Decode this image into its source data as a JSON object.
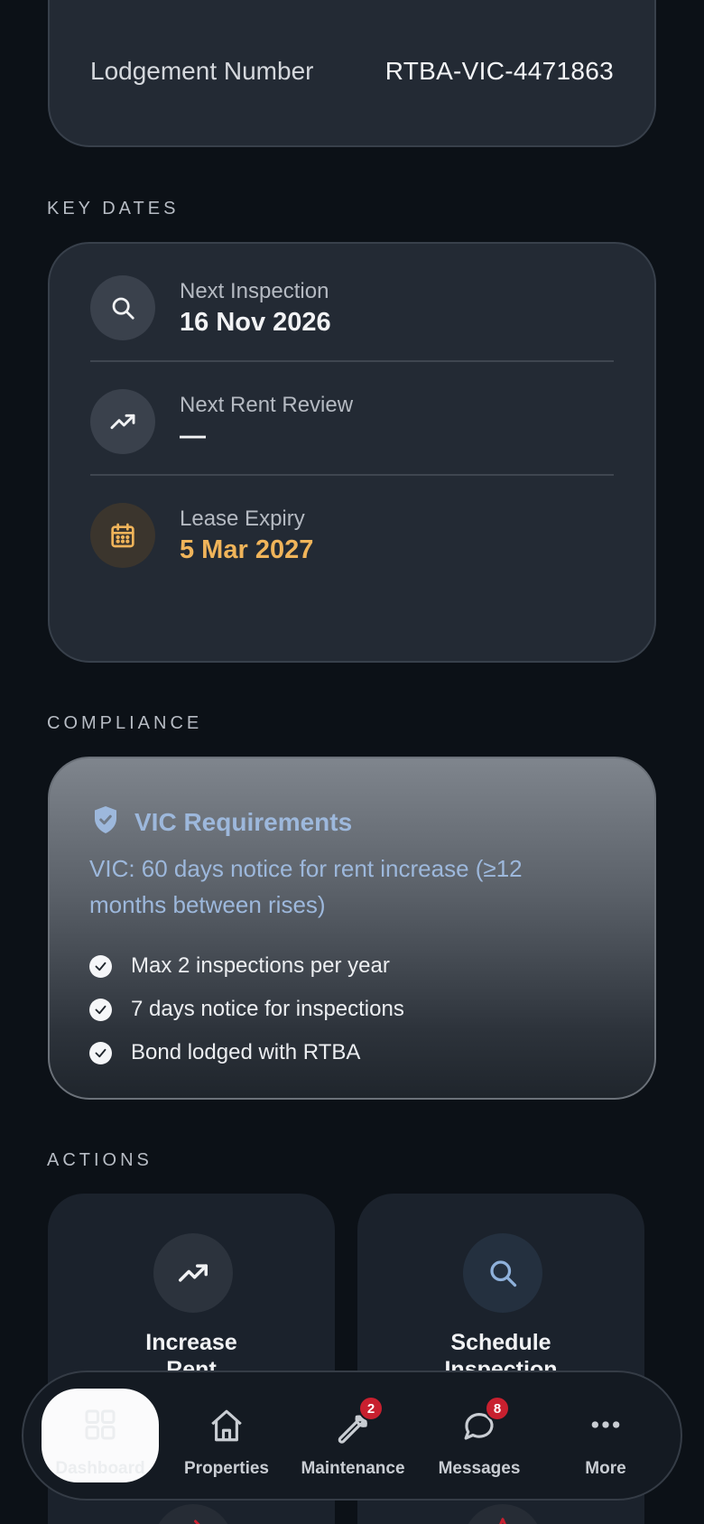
{
  "lease_details": {
    "partial_row_label": "Lodgement Number",
    "partial_row_value": "RTBA-VIC-4471863"
  },
  "sections": {
    "key_dates": "KEY DATES",
    "compliance": "COMPLIANCE",
    "actions": "ACTIONS"
  },
  "key_dates": [
    {
      "label": "Next Inspection",
      "value": "16 Nov 2026",
      "icon": "search-icon"
    },
    {
      "label": "Next Rent Review",
      "value": "—",
      "icon": "trending-up-icon"
    },
    {
      "label": "Lease Expiry",
      "value": "5 Mar 2027",
      "icon": "calendar-icon",
      "highlight_color": "#f0b45a"
    }
  ],
  "compliance": {
    "title": "VIC Requirements",
    "description": "VIC: 60 days notice for rent increase (≥12 months between rises)",
    "checks": [
      "Max 2 inspections per year",
      "7 days notice for inspections",
      "Bond lodged with RTBA"
    ]
  },
  "actions": [
    {
      "label": "Increase Rent",
      "icon": "trending-up-icon"
    },
    {
      "label": "Schedule Inspection",
      "icon": "search-icon"
    }
  ],
  "tabbar": {
    "tabs": [
      {
        "label": "Dashboard",
        "icon": "grid-icon",
        "active": true
      },
      {
        "label": "Properties",
        "icon": "home-icon"
      },
      {
        "label": "Maintenance",
        "icon": "wrench-icon",
        "badge": "2"
      },
      {
        "label": "Messages",
        "icon": "chat-icon",
        "badge": "8"
      },
      {
        "label": "More",
        "icon": "more-icon"
      }
    ]
  },
  "colors": {
    "background": "#0c1117",
    "card": "#232a34",
    "accent_blue": "#9db8dc",
    "warning": "#f0b45a",
    "badge": "#c8202f"
  }
}
